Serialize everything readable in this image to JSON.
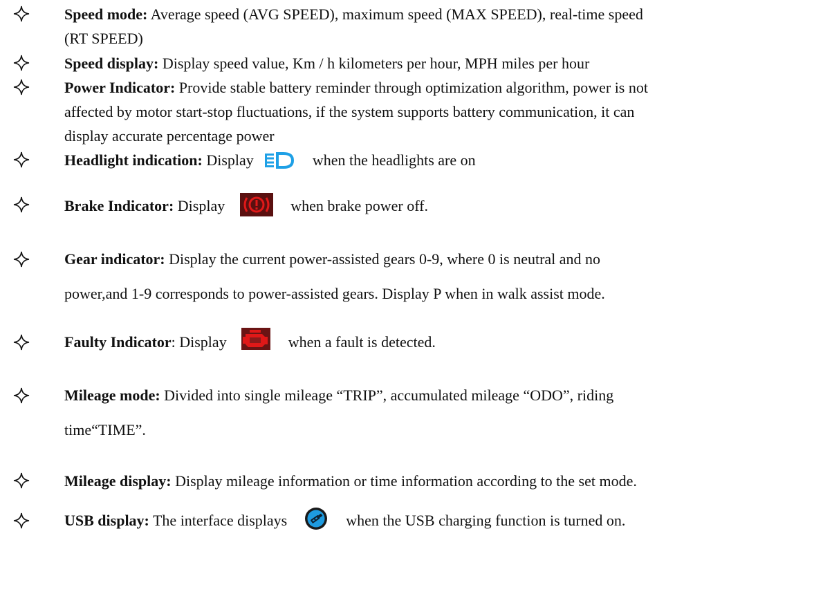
{
  "items": [
    {
      "label": "Speed mode:",
      "line1": " Average speed (AVG SPEED), maximum speed (MAX SPEED), real-time speed",
      "line2": "(RT SPEED)"
    },
    {
      "label": "Speed display:",
      "text": " Display speed value, Km / h kilometers per hour, MPH miles per hour"
    },
    {
      "label": "Power Indicator:",
      "line1": " Provide stable battery reminder through optimization algorithm, power is not",
      "line2": "affected by motor start-stop fluctuations, if the system supports battery communication, it can",
      "line3": "display accurate percentage power"
    },
    {
      "label": "Headlight indication:",
      "before": " Display",
      "after": "when the headlights are on",
      "icon": "headlight-icon"
    },
    {
      "label": "Brake Indicator:",
      "before": " Display",
      "after": "when brake power off.",
      "icon": "brake-warning-icon"
    },
    {
      "label": "Gear indicator:",
      "line1": " Display the current power-assisted gears 0-9, where 0 is neutral and no",
      "line2": "power,and 1-9 corresponds to power-assisted gears. Display P when in walk assist mode."
    },
    {
      "label": "Faulty Indicator",
      "colon": ":",
      "before": " Display",
      "after": "when a fault is detected.",
      "icon": "engine-fault-icon"
    },
    {
      "label": "Mileage mode:",
      "line1": " Divided into single mileage “TRIP”, accumulated mileage “ODO”, riding",
      "line2": "time“TIME”."
    },
    {
      "label": "Mileage display:",
      "text": " Display mileage information or time information according to the set mode."
    },
    {
      "label": "USB display:",
      "before": " The interface displays",
      "after": "when the USB charging function is turned on.",
      "icon": "usb-icon"
    }
  ],
  "colors": {
    "text": "#111111",
    "headlight_icon": "#1ea0e6",
    "brake_icon": "#e01818",
    "fault_icon": "#e01818",
    "usb_icon": "#1e9be0"
  }
}
